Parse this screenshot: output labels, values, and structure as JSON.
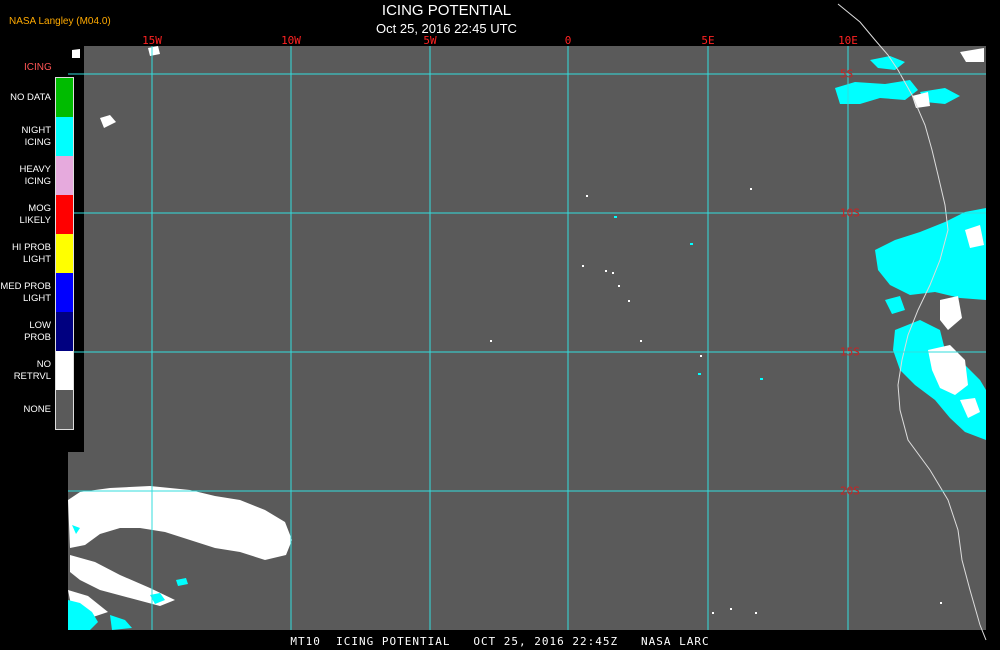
{
  "header": {
    "credit": "NASA Langley (M04.0)",
    "title": "ICING POTENTIAL",
    "subtitle": "Oct 25, 2016 22:45 UTC"
  },
  "map": {
    "background_color": "#5a5a5a",
    "grid_color": "#33dddd",
    "coast_color": "#dddddd",
    "longitude_labels": [
      "15W",
      "10W",
      "5W",
      "0",
      "5E",
      "10E"
    ],
    "latitude_labels": [
      "5S",
      "10S",
      "15S",
      "20S"
    ]
  },
  "legend": {
    "title": "ICING",
    "items": [
      {
        "label": "NO DATA",
        "color": "#00bb00"
      },
      {
        "label": "NIGHT\nICING",
        "color": "#00ffff"
      },
      {
        "label": "HEAVY\nICING",
        "color": "#e6aadd"
      },
      {
        "label": "MOG\nLIKELY",
        "color": "#ff0000"
      },
      {
        "label": "HI PROB\nLIGHT",
        "color": "#ffff00"
      },
      {
        "label": "MED PROB\nLIGHT",
        "color": "#0000ff"
      },
      {
        "label": "LOW\nPROB",
        "color": "#000080"
      },
      {
        "label": "NO\nRETRVL",
        "color": "#ffffff"
      },
      {
        "label": "NONE",
        "color": "#5a5a5a"
      }
    ]
  },
  "footer": {
    "text": "MT10  ICING POTENTIAL   OCT 25, 2016 22:45Z   NASA LARC"
  }
}
